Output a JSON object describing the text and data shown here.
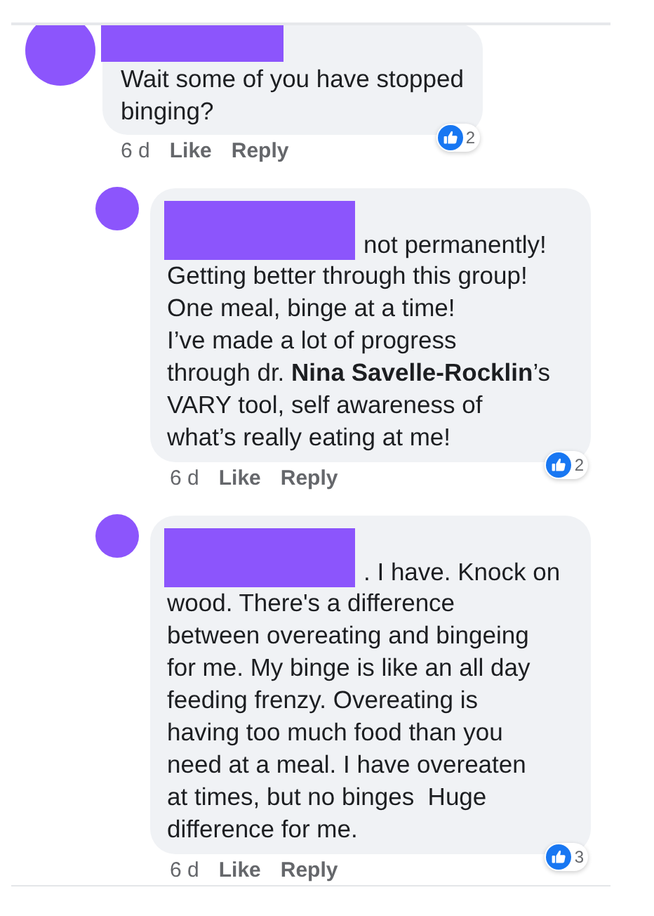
{
  "comments": [
    {
      "body": "Wait some of you have stopped\nbinging?",
      "time": "6 d",
      "actions": [
        "Like",
        "Reply"
      ],
      "reactions": "2",
      "children": [
        {
          "lead": "not permanently!",
          "body": "Getting better through this group!\nOne meal, binge at a time!\nI’ve made a lot of progress\nthrough dr. **Nina Savelle-Rocklin**’s\nVARY tool, self awareness of\nwhat’s really eating at me!",
          "time": "6 d",
          "actions": [
            "Like",
            "Reply"
          ],
          "reactions": "2"
        },
        {
          "lead": ". I have. Knock on",
          "body": "wood. There's a difference\nbetween overeating and bingeing\nfor me. My binge is like an all day\nfeeding frenzy. Overeating is\nhaving too much food than you\nneed at a meal. I have overeaten\nat times, but no binges  Huge\ndifference for me.",
          "time": "6 d",
          "actions": [
            "Like",
            "Reply"
          ],
          "reactions": "3"
        }
      ]
    }
  ]
}
